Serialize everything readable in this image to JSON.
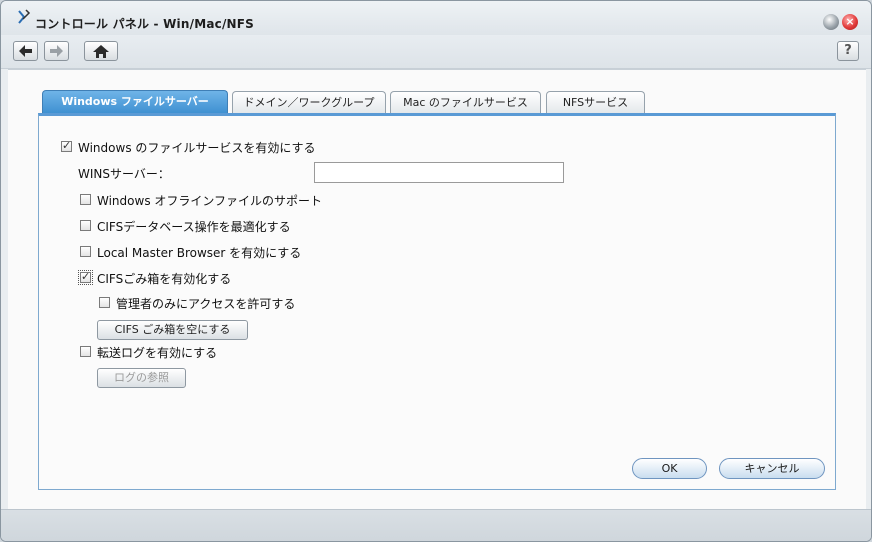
{
  "window": {
    "title": "コントロール パネル - Win/Mac/NFS"
  },
  "toolbar": {
    "back": "back",
    "forward": "forward",
    "home": "home",
    "help_label": "?"
  },
  "tabs": [
    {
      "label": "Windows ファイルサーバー",
      "active": true
    },
    {
      "label": "ドメイン／ワークグループ",
      "active": false
    },
    {
      "label": "Mac のファイルサービス",
      "active": false
    },
    {
      "label": "NFSサービス",
      "active": false
    }
  ],
  "form": {
    "enable_windows": {
      "label": "Windows のファイルサービスを有効にする",
      "checked": true
    },
    "wins_label": "WINSサーバー：",
    "wins_value": "",
    "offline_files": {
      "label": "Windows オフラインファイルのサポート",
      "checked": false
    },
    "cifs_db": {
      "label": "CIFSデータベース操作を最適化する",
      "checked": false
    },
    "local_master": {
      "label": "Local Master Browser を有効にする",
      "checked": false
    },
    "recycle_bin": {
      "label": "CIFSごみ箱を有効化する",
      "checked": true
    },
    "admin_only": {
      "label": "管理者のみにアクセスを許可する",
      "checked": false
    },
    "empty_bin_button": "CIFS ごみ箱を空にする",
    "transfer_log": {
      "label": "転送ログを有効にする",
      "checked": false
    },
    "view_log_button": "ログの参照"
  },
  "buttons": {
    "ok": "OK",
    "cancel": "キャンセル"
  }
}
